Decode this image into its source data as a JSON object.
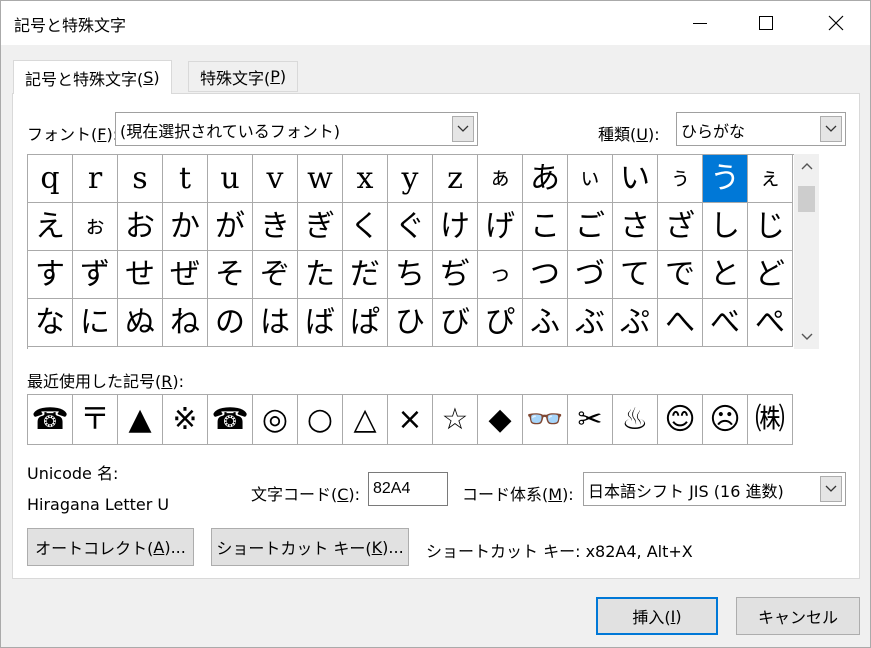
{
  "window": {
    "title": "記号と特殊文字"
  },
  "tabs": [
    {
      "label": "記号と特殊文字(",
      "key": "S",
      "suffix": ")"
    },
    {
      "label": "特殊文字(",
      "key": "P",
      "suffix": ")"
    }
  ],
  "font": {
    "label": "フォント(",
    "key": "F",
    "suffix": "):",
    "value": "(現在選択されているフォント)"
  },
  "subset": {
    "label": "種類(",
    "key": "U",
    "suffix": "):",
    "value": "ひらがな"
  },
  "char_grid": {
    "rows": [
      [
        "q",
        "r",
        "s",
        "t",
        "u",
        "v",
        "w",
        "x",
        "y",
        "z",
        "ぁ",
        "あ",
        "ぃ",
        "い",
        "ぅ",
        "う",
        "ぇ"
      ],
      [
        "え",
        "ぉ",
        "お",
        "か",
        "が",
        "き",
        "ぎ",
        "く",
        "ぐ",
        "け",
        "げ",
        "こ",
        "ご",
        "さ",
        "ざ",
        "し",
        "じ"
      ],
      [
        "す",
        "ず",
        "せ",
        "ぜ",
        "そ",
        "ぞ",
        "た",
        "だ",
        "ち",
        "ぢ",
        "っ",
        "つ",
        "づ",
        "て",
        "で",
        "と",
        "ど"
      ],
      [
        "な",
        "に",
        "ぬ",
        "ね",
        "の",
        "は",
        "ば",
        "ぱ",
        "ひ",
        "び",
        "ぴ",
        "ふ",
        "ぶ",
        "ぷ",
        "へ",
        "べ",
        "ぺ"
      ]
    ],
    "selected": "う"
  },
  "recent": {
    "label": "最近使用した記号(",
    "key": "R",
    "suffix": "):",
    "symbols": [
      "☎",
      "〒",
      "▲",
      "※",
      "☎",
      "◎",
      "○",
      "△",
      "×",
      "☆",
      "◆",
      "👓",
      "✂",
      "♨",
      "😊",
      "☹",
      "㈱"
    ]
  },
  "unicode": {
    "label": "Unicode 名:",
    "name": "Hiragana Letter U"
  },
  "char_code": {
    "label": "文字コード(",
    "key": "C",
    "suffix": "):",
    "value": "82A4"
  },
  "code_system": {
    "label": "コード体系(",
    "key": "M",
    "suffix": "):",
    "value": "日本語シフト JIS (16 進数)"
  },
  "buttons": {
    "autocorrect": {
      "label": "オートコレクト(",
      "key": "A",
      "suffix": ")..."
    },
    "shortcut": {
      "label": "ショートカット キー(",
      "key": "K",
      "suffix": ")..."
    },
    "insert": {
      "label": "挿入(",
      "key": "I",
      "suffix": ")"
    },
    "cancel": "キャンセル"
  },
  "shortcut_info": "ショートカット キー: x82A4, Alt+X"
}
